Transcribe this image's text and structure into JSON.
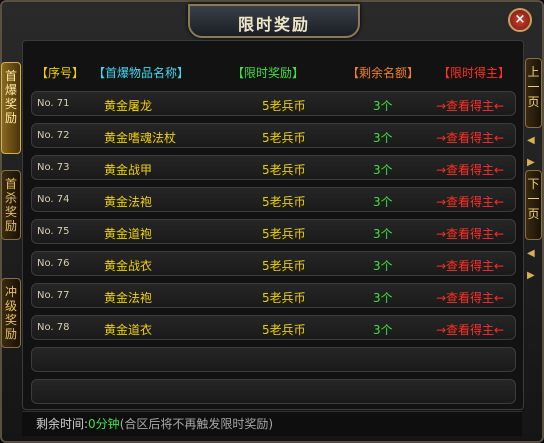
{
  "window": {
    "title": "限时奖励",
    "close_glyph": "×"
  },
  "side_tabs": [
    {
      "label": "首爆奖励",
      "chars": [
        "首",
        "爆",
        "奖",
        "励"
      ],
      "active": true
    },
    {
      "label": "首杀奖励",
      "chars": [
        "首",
        "杀",
        "奖",
        "励"
      ],
      "active": false
    },
    {
      "label": "冲级奖励",
      "chars": [
        "冲",
        "级",
        "奖",
        "励"
      ],
      "active": false
    }
  ],
  "headers": {
    "no": "【序号】",
    "name": "【首爆物品名称】",
    "reward": "【限时奖励】",
    "remaining": "【剩余名额】",
    "winner": "【限时得主】"
  },
  "rows": [
    {
      "no": "No. 71",
      "name": "黄金屠龙",
      "reward": "5老兵币",
      "remaining": "3个",
      "action": "→查看得主←"
    },
    {
      "no": "No. 72",
      "name": "黄金嗜魂法杖",
      "reward": "5老兵币",
      "remaining": "3个",
      "action": "→查看得主←"
    },
    {
      "no": "No. 73",
      "name": "黄金战甲",
      "reward": "5老兵币",
      "remaining": "3个",
      "action": "→查看得主←"
    },
    {
      "no": "No. 74",
      "name": "黄金法袍",
      "reward": "5老兵币",
      "remaining": "3个",
      "action": "→查看得主←"
    },
    {
      "no": "No. 75",
      "name": "黄金道袍",
      "reward": "5老兵币",
      "remaining": "3个",
      "action": "→查看得主←"
    },
    {
      "no": "No. 76",
      "name": "黄金战衣",
      "reward": "5老兵币",
      "remaining": "3个",
      "action": "→查看得主←"
    },
    {
      "no": "No. 77",
      "name": "黄金法袍",
      "reward": "5老兵币",
      "remaining": "3个",
      "action": "→查看得主←"
    },
    {
      "no": "No. 78",
      "name": "黄金道衣",
      "reward": "5老兵币",
      "remaining": "3个",
      "action": "→查看得主←"
    }
  ],
  "pager": {
    "prev": {
      "label": "上一页",
      "chars": [
        "上",
        "一",
        "页"
      ]
    },
    "next": {
      "label": "下一页",
      "chars": [
        "下",
        "一",
        "页"
      ]
    }
  },
  "footer": {
    "label": "剩余时间:",
    "value": "0分钟",
    "note": "(合区后将不再触发限时奖励)"
  },
  "colors": {
    "header_no": "#f0d000",
    "header_name": "#40d8f0",
    "header_reward": "#40e040",
    "header_remaining": "#f08020",
    "header_winner": "#ff3020"
  }
}
